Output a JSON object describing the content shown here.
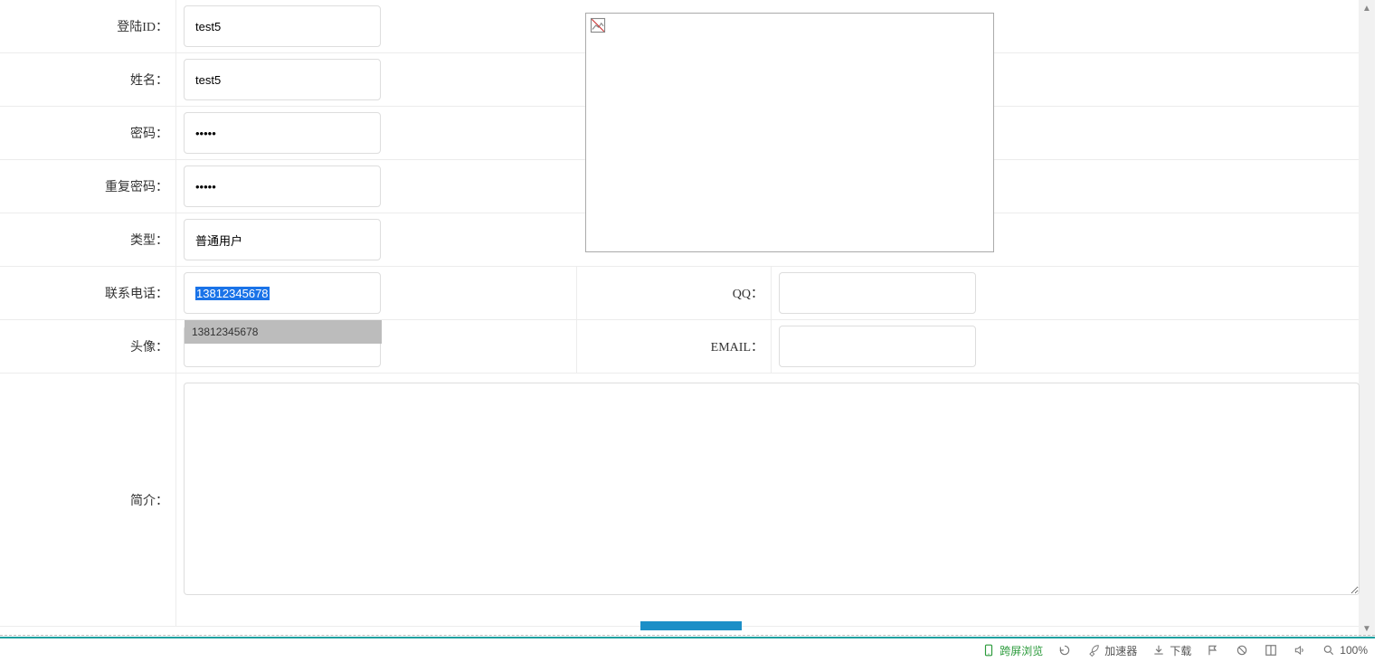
{
  "form": {
    "login_id_label": "登陆ID：",
    "login_id_value": "test5",
    "name_label": "姓名：",
    "name_value": "test5",
    "password_label": "密码：",
    "password_value": "•••••",
    "repeat_password_label": "重复密码：",
    "repeat_password_value": "•••••",
    "type_label": "类型：",
    "type_value": "普通用户",
    "phone_label": "联系电话：",
    "phone_value": "13812345678",
    "qq_label": "QQ：",
    "qq_value": "",
    "avatar_label": "头像：",
    "avatar_value": "",
    "email_label": "EMAIL：",
    "email_value": "",
    "bio_label": "简介：",
    "bio_value": ""
  },
  "autocomplete": {
    "suggestion": "13812345678"
  },
  "statusbar": {
    "cross_screen": "跨屏浏览",
    "accel": "加速器",
    "download": "下载",
    "zoom": "100%"
  }
}
